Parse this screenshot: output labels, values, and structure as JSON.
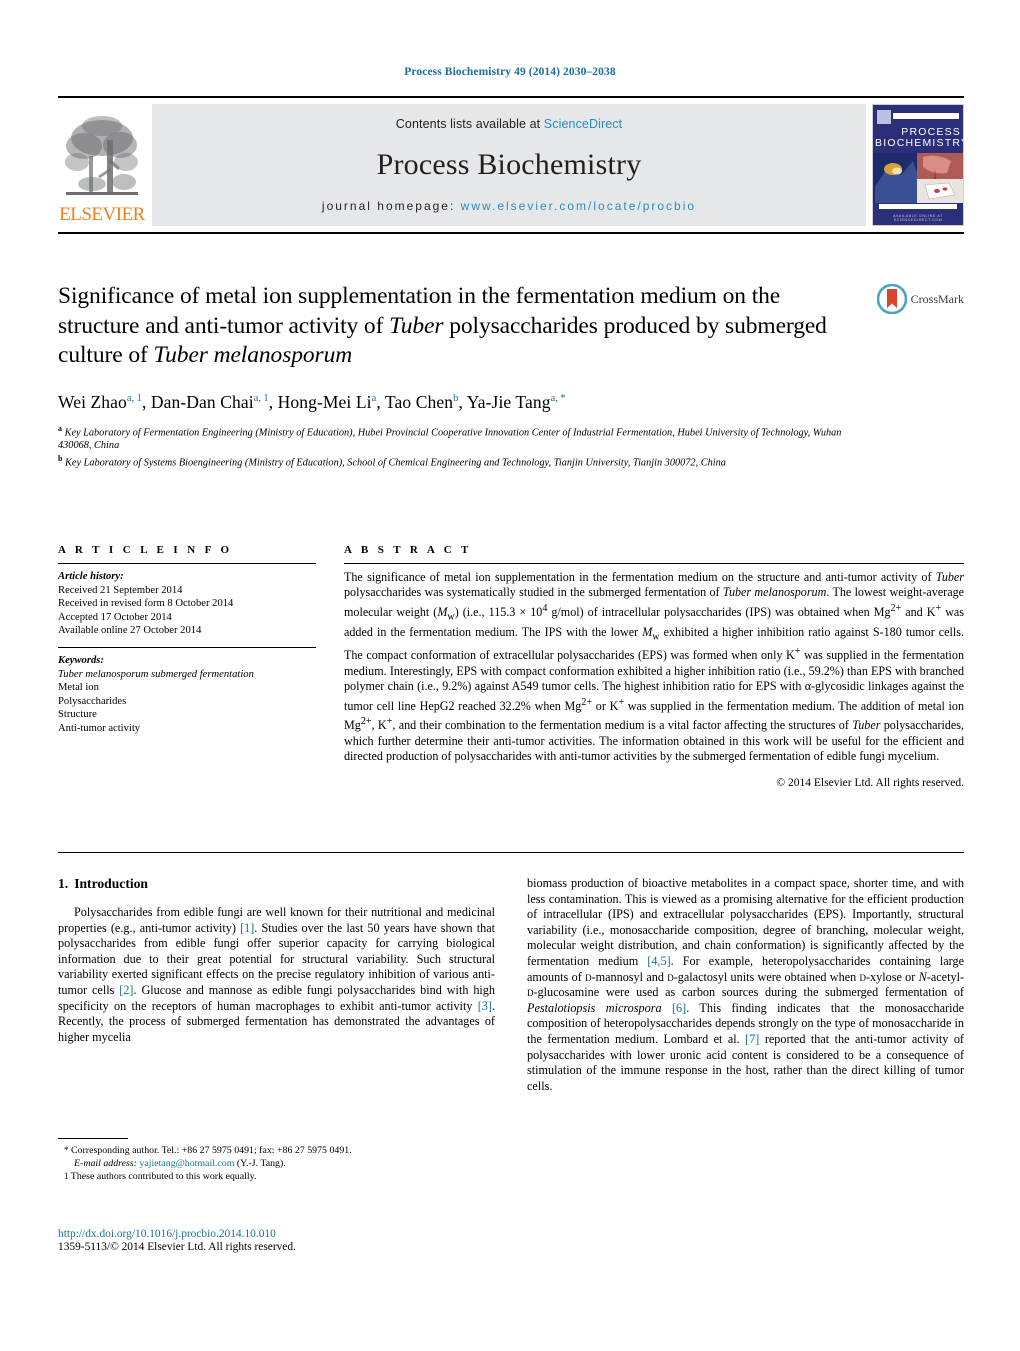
{
  "running_head": "Process Biochemistry 49 (2014) 2030–2038",
  "masthead": {
    "contents_prefix": "Contents lists available at ",
    "sciencedirect": "ScienceDirect",
    "journal_name": "Process Biochemistry",
    "homepage_prefix": "journal homepage: ",
    "homepage_url": "www.elsevier.com/locate/procbio",
    "publisher_word": "ELSEVIER",
    "cover_title_line1": "PROCESS",
    "cover_title_line2": "BIOCHEMISTRY",
    "cover_footer": "AVAILABLE ONLINE AT SCIENCEDIRECT.COM",
    "accent_blue": "#2b8cbe",
    "elsevier_orange": "#EE7F1A",
    "band_gray": "#e6e7e8"
  },
  "article": {
    "title_html": "Significance of metal ion supplementation in the fermentation medium on the structure and anti-tumor activity of <i>Tuber</i> polysaccharides produced by submerged culture of <i>Tuber melanosporum</i>",
    "crossmark_label": "CrossMark",
    "authors_html": "Wei Zhao<sup>a, 1</sup>, Dan-Dan Chai<sup>a, 1</sup>, Hong-Mei Li<sup>a</sup>, Tao Chen<sup>b</sup>, Ya-Jie Tang<sup>a, *</sup>",
    "affiliation_a": "Key Laboratory of Fermentation Engineering (Ministry of Education), Hubei Provincial Cooperative Innovation Center of Industrial Fermentation, Hubei University of Technology, Wuhan 430068, China",
    "affiliation_b": "Key Laboratory of Systems Bioengineering (Ministry of Education), School of Chemical Engineering and Technology, Tianjin University, Tianjin 300072, China"
  },
  "article_info": {
    "heading": "A R T I C L E   I N F O",
    "history_label": "Article history:",
    "history": [
      "Received 21 September 2014",
      "Received in revised form 8 October 2014",
      "Accepted 17 October 2014",
      "Available online 27 October 2014"
    ],
    "keywords_label": "Keywords:",
    "keywords": [
      "Tuber melanosporum submerged fermentation",
      "Metal ion",
      "Polysaccharides",
      "Structure",
      "Anti-tumor activity"
    ]
  },
  "abstract": {
    "heading": "A B S T R A C T",
    "text_html": "The significance of metal ion supplementation in the fermentation medium on the structure and anti-tumor activity of <i>Tuber</i> polysaccharides was systematically studied in the submerged fermentation of <i>Tuber melanosporum</i>. The lowest weight-average molecular weight (<i>M</i><sub>w</sub>) (i.e., 115.3 &#215; 10<sup>4</sup> g/mol) of intracellular polysaccharides (IPS) was obtained when Mg<sup>2+</sup> and K<sup>+</sup> was added in the fermentation medium. The IPS with the lower <i>M</i><sub>w</sub> exhibited a higher inhibition ratio against S-180 tumor cells. The compact conformation of extracellular polysaccharides (EPS) was formed when only K<sup>+</sup> was supplied in the fermentation medium. Interestingly, EPS with compact conformation exhibited a higher inhibition ratio (i.e., 59.2%) than EPS with branched polymer chain (i.e., 9.2%) against A549 tumor cells. The highest inhibition ratio for EPS with &#945;-glycosidic linkages against the tumor cell line HepG2 reached 32.2% when Mg<sup>2+</sup> or K<sup>+</sup> was supplied in the fermentation medium. The addition of metal ion Mg<sup>2+</sup>, K<sup>+</sup>, and their combination to the fermentation medium is a vital factor affecting the structures of <i>Tuber</i> polysaccharides, which further determine their anti-tumor activities. The information obtained in this work will be useful for the efficient and directed production of polysaccharides with anti-tumor activities by the submerged fermentation of edible fungi mycelium.",
    "copyright": "© 2014 Elsevier Ltd. All rights reserved."
  },
  "body": {
    "section_number": "1.",
    "section_title": "Introduction",
    "left_paragraph_html": "Polysaccharides from edible fungi are well known for their nutritional and medicinal properties (e.g., anti-tumor activity) <span class=\"ref\">[1]</span>. Studies over the last 50 years have shown that polysaccharides from edible fungi offer superior capacity for carrying biological information due to their great potential for structural variability. Such structural variability exerted significant effects on the precise regulatory inhibition of various anti-tumor cells <span class=\"ref\">[2]</span>. Glucose and mannose as edible fungi polysaccharides bind with high specificity on the receptors of human macrophages to exhibit anti-tumor activity <span class=\"ref\">[3]</span>. Recently, the process of submerged fermentation has demonstrated the advantages of higher mycelia",
    "right_paragraph_html": "biomass production of bioactive metabolites in a compact space, shorter time, and with less contamination. This is viewed as a promising alternative for the efficient production of intracellular (IPS) and extracellular polysaccharides (EPS). Importantly, structural variability (i.e., monosaccharide composition, degree of branching, molecular weight, molecular weight distribution, and chain conformation) is significantly affected by the fermentation medium <span class=\"ref\">[4,5]</span>. For example, heteropolysaccharides containing large amounts of <span class=\"sc\">d</span>-mannosyl and <span class=\"sc\">d</span>-galactosyl units were obtained when <span class=\"sc\">d</span>-xylose or <i>N</i>-acetyl-<span class=\"sc\">d</span>-glucosamine were used as carbon sources during the submerged fermentation of <i>Pestalotiopsis microspora</i> <span class=\"ref\">[6]</span>. This finding indicates that the monosaccharide composition of heteropolysaccharides depends strongly on the type of monosaccharide in the fermentation medium. Lombard et al. <span class=\"ref\">[7]</span> reported that the anti-tumor activity of polysaccharides with lower uronic acid content is considered to be a consequence of stimulation of the immune response in the host, rather than the direct killing of tumor cells."
  },
  "footnotes": {
    "corresponding_mark": "*",
    "corresponding_html": "Corresponding author. Tel.: +86 27 5975 0491; fax: +86 27 5975 0491.",
    "email_label": "E-mail address:",
    "email": "yajietang@hotmail.com",
    "email_suffix": "(Y.-J. Tang).",
    "equal_mark": "1",
    "equal_contrib": "These authors contributed to this work equally."
  },
  "footer": {
    "doi_url": "http://dx.doi.org/10.1016/j.procbio.2014.10.010",
    "issn_line": "1359-5113/© 2014 Elsevier Ltd. All rights reserved."
  }
}
